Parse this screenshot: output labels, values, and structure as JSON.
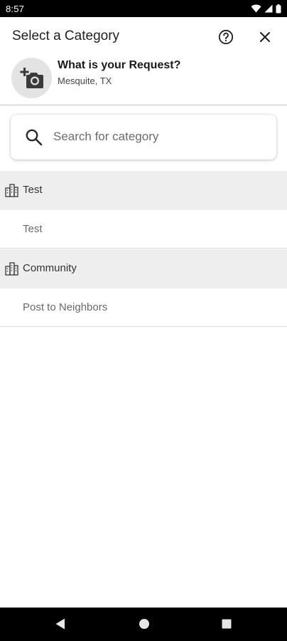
{
  "status_bar": {
    "time": "8:57"
  },
  "header": {
    "title": "Select a Category"
  },
  "request": {
    "title": "What is your Request?",
    "location": "Mesquite, TX"
  },
  "search": {
    "placeholder": "Search for category"
  },
  "categories": [
    {
      "group": "Test",
      "items": [
        "Test"
      ]
    },
    {
      "group": "Community",
      "items": [
        "Post to Neighbors"
      ]
    }
  ],
  "colors": {
    "status_bar": "#000000",
    "group_background": "#eeeeee",
    "photo_circle": "#e3e3e3",
    "nav_bar": "#000000"
  },
  "icons": {
    "header": [
      "help-icon",
      "close-icon"
    ],
    "request": "add-camera-icon",
    "search": "search-icon",
    "group": "building-icon",
    "nav": [
      "back-icon",
      "home-icon",
      "recents-icon"
    ]
  }
}
